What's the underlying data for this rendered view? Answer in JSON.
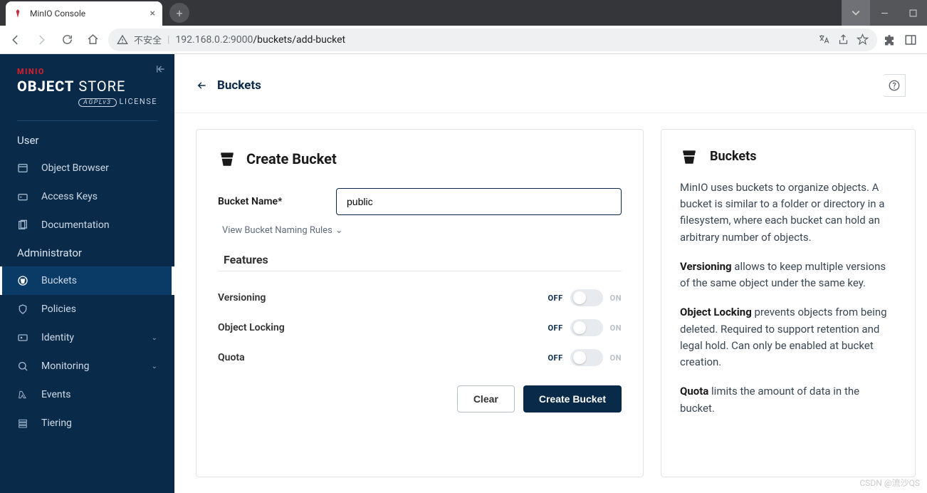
{
  "browser": {
    "tab_title": "MinIO Console",
    "insecure_label": "不安全",
    "url_host": "192.168.0.2",
    "url_port": ":9000",
    "url_path": "/buckets/add-bucket"
  },
  "sidebar": {
    "brand_top": "MINIO",
    "brand_bold": "OBJECT",
    "brand_thin": " STORE",
    "license_badge": "AGPLv3",
    "license_text": "LICENSE",
    "sections": {
      "user": "User",
      "admin": "Administrator"
    },
    "user_items": [
      {
        "label": "Object Browser",
        "name": "object-browser"
      },
      {
        "label": "Access Keys",
        "name": "access-keys"
      },
      {
        "label": "Documentation",
        "name": "documentation"
      }
    ],
    "admin_items": [
      {
        "label": "Buckets",
        "name": "buckets",
        "active": true
      },
      {
        "label": "Policies",
        "name": "policies"
      },
      {
        "label": "Identity",
        "name": "identity",
        "expandable": true
      },
      {
        "label": "Monitoring",
        "name": "monitoring",
        "expandable": true
      },
      {
        "label": "Events",
        "name": "events"
      },
      {
        "label": "Tiering",
        "name": "tiering"
      }
    ]
  },
  "page": {
    "title": "Buckets"
  },
  "form": {
    "heading": "Create Bucket",
    "name_label": "Bucket Name*",
    "name_value": "public",
    "naming_rules_link": "View Bucket Naming Rules",
    "features_heading": "Features",
    "features": [
      {
        "label": "Versioning",
        "off": "OFF",
        "on": "ON",
        "state": "off"
      },
      {
        "label": "Object Locking",
        "off": "OFF",
        "on": "ON",
        "state": "off"
      },
      {
        "label": "Quota",
        "off": "OFF",
        "on": "ON",
        "state": "off"
      }
    ],
    "clear_btn": "Clear",
    "submit_btn": "Create Bucket"
  },
  "info": {
    "heading": "Buckets",
    "p1": "MinIO uses buckets to organize objects. A bucket is similar to a folder or directory in a filesystem, where each bucket can hold an arbitrary number of objects.",
    "p2_b": "Versioning",
    "p2": " allows to keep multiple versions of the same object under the same key.",
    "p3_b": "Object Locking",
    "p3": " prevents objects from being deleted. Required to support retention and legal hold. Can only be enabled at bucket creation.",
    "p4_b": "Quota",
    "p4": " limits the amount of data in the bucket."
  },
  "watermark": "CSDN @流沙QS"
}
